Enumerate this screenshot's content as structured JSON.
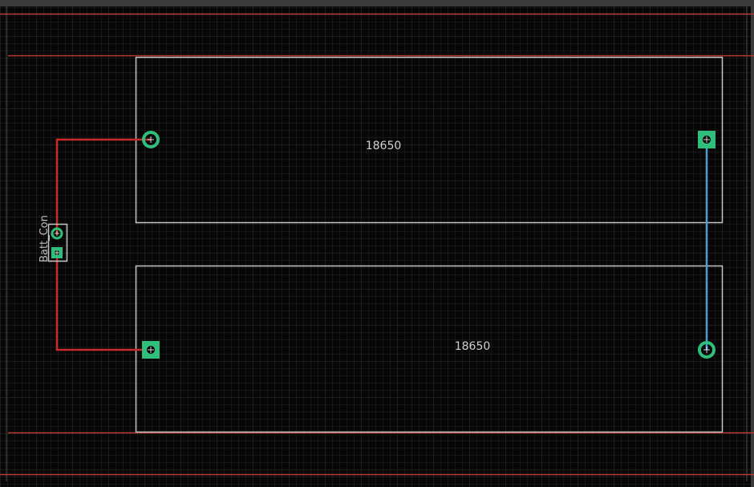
{
  "editor": {
    "board_labels": [
      "18650",
      "18650"
    ],
    "connector_ref": "Batt_Con"
  },
  "colors": {
    "background": "#070707",
    "frame": "#3a3a3a",
    "grid_minor": "#272727",
    "grid_major": "#343434",
    "board_outline": "#c0392b",
    "silkscreen": "#c8c8c8",
    "pad": "#2fbf7a",
    "trace_top": "#cc2a2a",
    "trace_bottom": "#4a9ed1"
  },
  "icons": {
    "pad_square": "square-pad-icon",
    "pad_round": "round-pad-icon",
    "drill_cross": "crosshair-icon"
  }
}
